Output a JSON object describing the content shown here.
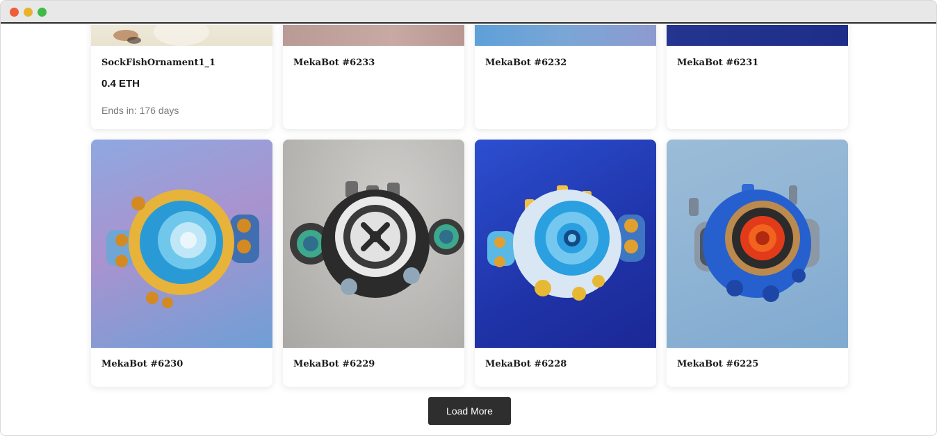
{
  "nfts_row1": [
    {
      "title": "SockFishOrnament1_1",
      "price": "0.4 ETH",
      "ends_label": "Ends in:",
      "ends_value": "176 days"
    },
    {
      "title": "MekaBot #6233"
    },
    {
      "title": "MekaBot #6232"
    },
    {
      "title": "MekaBot #6231"
    }
  ],
  "nfts_row2": [
    {
      "title": "MekaBot #6230"
    },
    {
      "title": "MekaBot #6229"
    },
    {
      "title": "MekaBot #6228"
    },
    {
      "title": "MekaBot #6225"
    }
  ],
  "load_more_label": "Load More"
}
